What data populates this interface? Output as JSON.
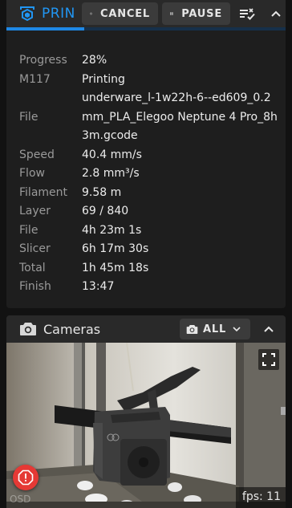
{
  "status": {
    "title": "PRINTING",
    "cancel_label": "CANCEL",
    "pause_label": "PAUSE",
    "progress_fraction": 0.28,
    "accent_color": "#2196f3",
    "rows": [
      {
        "label": "Progress",
        "value": "28%"
      },
      {
        "label": "M117",
        "value": "Printing"
      },
      {
        "label": "File",
        "value": "underware_l-1w22h-6--ed609_0.2mm_PLA_Elegoo Neptune 4 Pro_8h3m.gcode"
      },
      {
        "label": "Speed",
        "value": "40.4 mm/s"
      },
      {
        "label": "Flow",
        "value": "2.8 mm³/s"
      },
      {
        "label": "Filament",
        "value": "9.58 m"
      },
      {
        "label": "Layer",
        "value": "69 / 840"
      },
      {
        "label": "File",
        "value": "4h 23m 1s"
      },
      {
        "label": "Slicer",
        "value": "6h 17m 30s"
      },
      {
        "label": "Total",
        "value": "1h 45m 18s"
      },
      {
        "label": "Finish",
        "value": "13:47"
      }
    ]
  },
  "cameras": {
    "title": "Cameras",
    "filter_label": "ALL",
    "fps_text": "fps: 11",
    "osd_text": "OSD"
  },
  "icons": {
    "logo": "printer-cube-icon",
    "cancel": "cancel-icon",
    "pause": "pause-icon",
    "queue": "playlist-check-icon",
    "collapse": "chevron-up-icon",
    "camera": "camera-icon",
    "dropdown": "chevron-down-icon",
    "fullscreen": "fullscreen-icon",
    "fab": "emergency-stop-icon"
  }
}
